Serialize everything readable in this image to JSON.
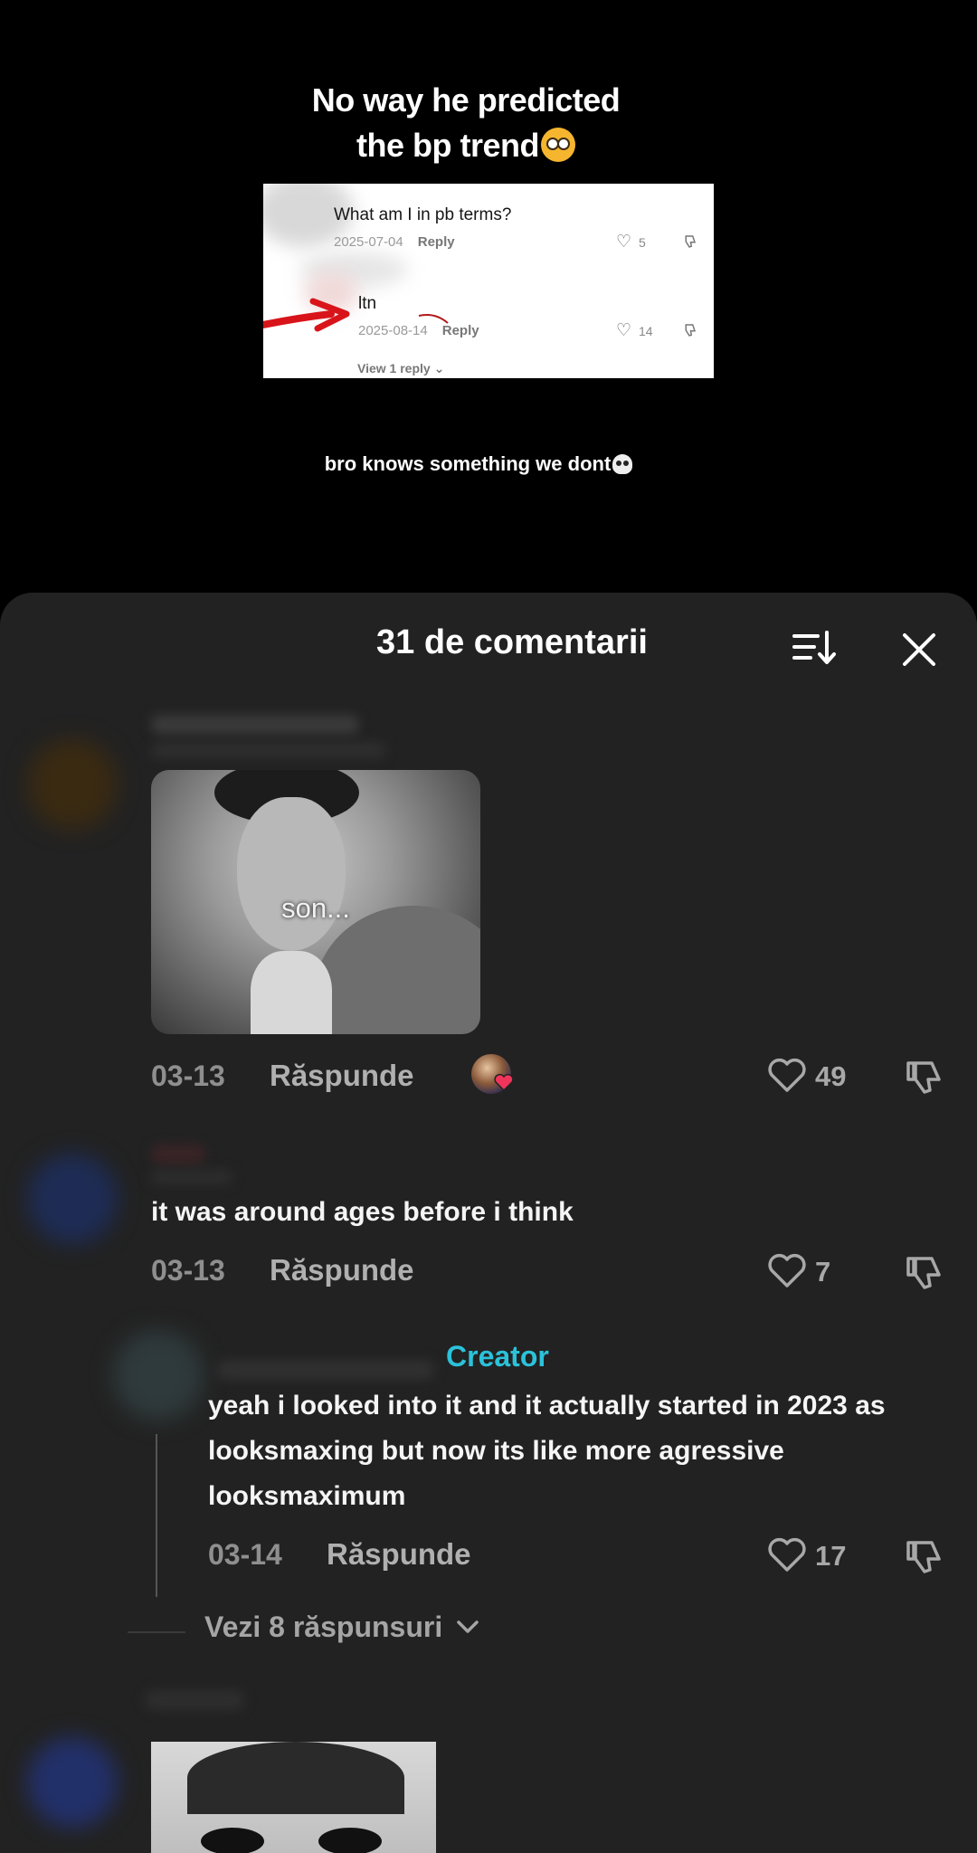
{
  "video": {
    "title_line1": "No way he predicted",
    "title_line2": "the bp trend",
    "caption": "bro knows something we dont",
    "embedded_comments": [
      {
        "text": "What am I in pb terms?",
        "date": "2025-07-04",
        "reply": "Reply",
        "likes": "5"
      },
      {
        "text": "ltn",
        "date": "2025-08-14",
        "reply": "Reply",
        "likes": "14"
      }
    ],
    "view_reply": "View 1 reply"
  },
  "sheet": {
    "title": "31 de comentarii"
  },
  "comments": [
    {
      "sticker_text": "son...",
      "date": "03-13",
      "reply": "Răspunde",
      "likes": "49"
    },
    {
      "text": "it was around ages before i think",
      "date": "03-13",
      "reply": "Răspunde",
      "likes": "7"
    }
  ],
  "reply": {
    "badge": "Creator",
    "text_line1": "yeah i looked into it and it actually started in 2023 as",
    "text_line2": "looksmaxing but now its like more agressive",
    "text_line3": "looksmaximum",
    "date": "03-14",
    "reply": "Răspunde",
    "likes": "17"
  },
  "view_replies": "Vezi 8 răspunsuri",
  "colors": {
    "sheet_bg": "#222222",
    "creator_accent": "#2bc2da",
    "meta_text": "#8f8f8f"
  },
  "icons": [
    "sort-icon",
    "close-icon",
    "heart-icon",
    "dislike-icon",
    "chevron-down-icon",
    "flushed-face-emoji",
    "skull-emoji"
  ]
}
